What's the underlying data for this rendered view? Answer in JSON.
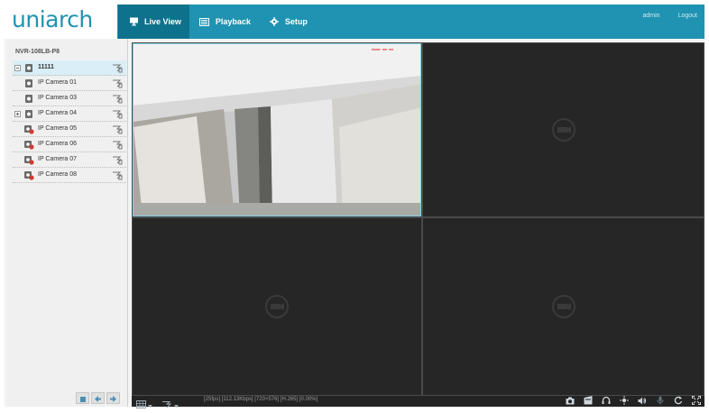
{
  "brand": {
    "logo_text": "uniarch",
    "accent": "#1f93b1",
    "accent_dark": "#0f728d"
  },
  "nav": {
    "tabs": [
      {
        "label": "Live View",
        "icon": "monitor-icon",
        "active": true
      },
      {
        "label": "Playback",
        "icon": "playback-icon",
        "active": false
      },
      {
        "label": "Setup",
        "icon": "gear-icon",
        "active": false
      }
    ]
  },
  "user": {
    "name": "admin",
    "logout": "Logout"
  },
  "device_panel": {
    "title": "NVR-108LB-P8",
    "root": {
      "label": "11111",
      "status": "online"
    },
    "cameras": [
      {
        "label": "IP Camera 01",
        "status": "online"
      },
      {
        "label": "IP Camera 03",
        "status": "online"
      },
      {
        "label": "IP Camera 04",
        "status": "online"
      },
      {
        "label": "IP Camera 05",
        "status": "offline"
      },
      {
        "label": "IP Camera 06",
        "status": "offline"
      },
      {
        "label": "IP Camera 07",
        "status": "offline"
      },
      {
        "label": "IP Camera 08",
        "status": "offline"
      }
    ]
  },
  "status_bar": {
    "text": "[25fps] [112.13Kbps] [720×576] [H.265] [0.00%]",
    "right_icons": [
      "snapshot-icon",
      "record-icon",
      "headset-icon",
      "zoom-icon",
      "volume-icon",
      "microphone-icon",
      "refresh-icon",
      "fullscreen-icon"
    ]
  },
  "colors": {
    "offline": "#d33a2c",
    "video_bg": "#262626",
    "selected_border": "#7fd1e6"
  }
}
